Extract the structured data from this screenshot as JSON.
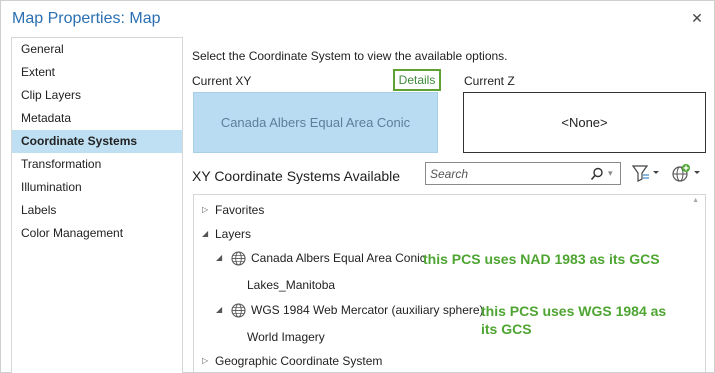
{
  "window": {
    "title": "Map Properties: Map",
    "close_glyph": "✕"
  },
  "sidebar": {
    "items": [
      {
        "label": "General"
      },
      {
        "label": "Extent"
      },
      {
        "label": "Clip Layers"
      },
      {
        "label": "Metadata"
      },
      {
        "label": "Coordinate Systems",
        "selected": true
      },
      {
        "label": "Transformation"
      },
      {
        "label": "Illumination"
      },
      {
        "label": "Labels"
      },
      {
        "label": "Color Management"
      }
    ]
  },
  "main": {
    "hint": "Select the Coordinate System to view the available options.",
    "current_xy_label": "Current XY",
    "details_label": "Details",
    "current_z_label": "Current Z",
    "current_xy_value": "Canada Albers Equal Area Conic",
    "current_z_value": "<None>",
    "available_title": "XY Coordinate Systems Available",
    "search_placeholder": "Search",
    "icons": [
      "search-icon",
      "filter-icon",
      "add-coordinate-system-icon"
    ]
  },
  "tree": {
    "favorites": "Favorites",
    "layers": "Layers",
    "crs1": "Canada Albers Equal Area Conic",
    "crs1_layer": "Lakes_Manitoba",
    "crs2": "WGS 1984 Web Mercator (auxiliary sphere)",
    "crs2_layer": "World Imagery",
    "geographic": "Geographic Coordinate System"
  },
  "annotations": {
    "note1": "this PCS uses NAD 1983 as its GCS",
    "note2_line1": "this PCS uses WGS 1984 as",
    "note2_line2": "its GCS"
  },
  "colors": {
    "accent_title": "#2a6fb2",
    "selection": "#bfe0f3",
    "annotation_green": "#4ea532",
    "current_xy_fill": "#b9dcf2"
  }
}
